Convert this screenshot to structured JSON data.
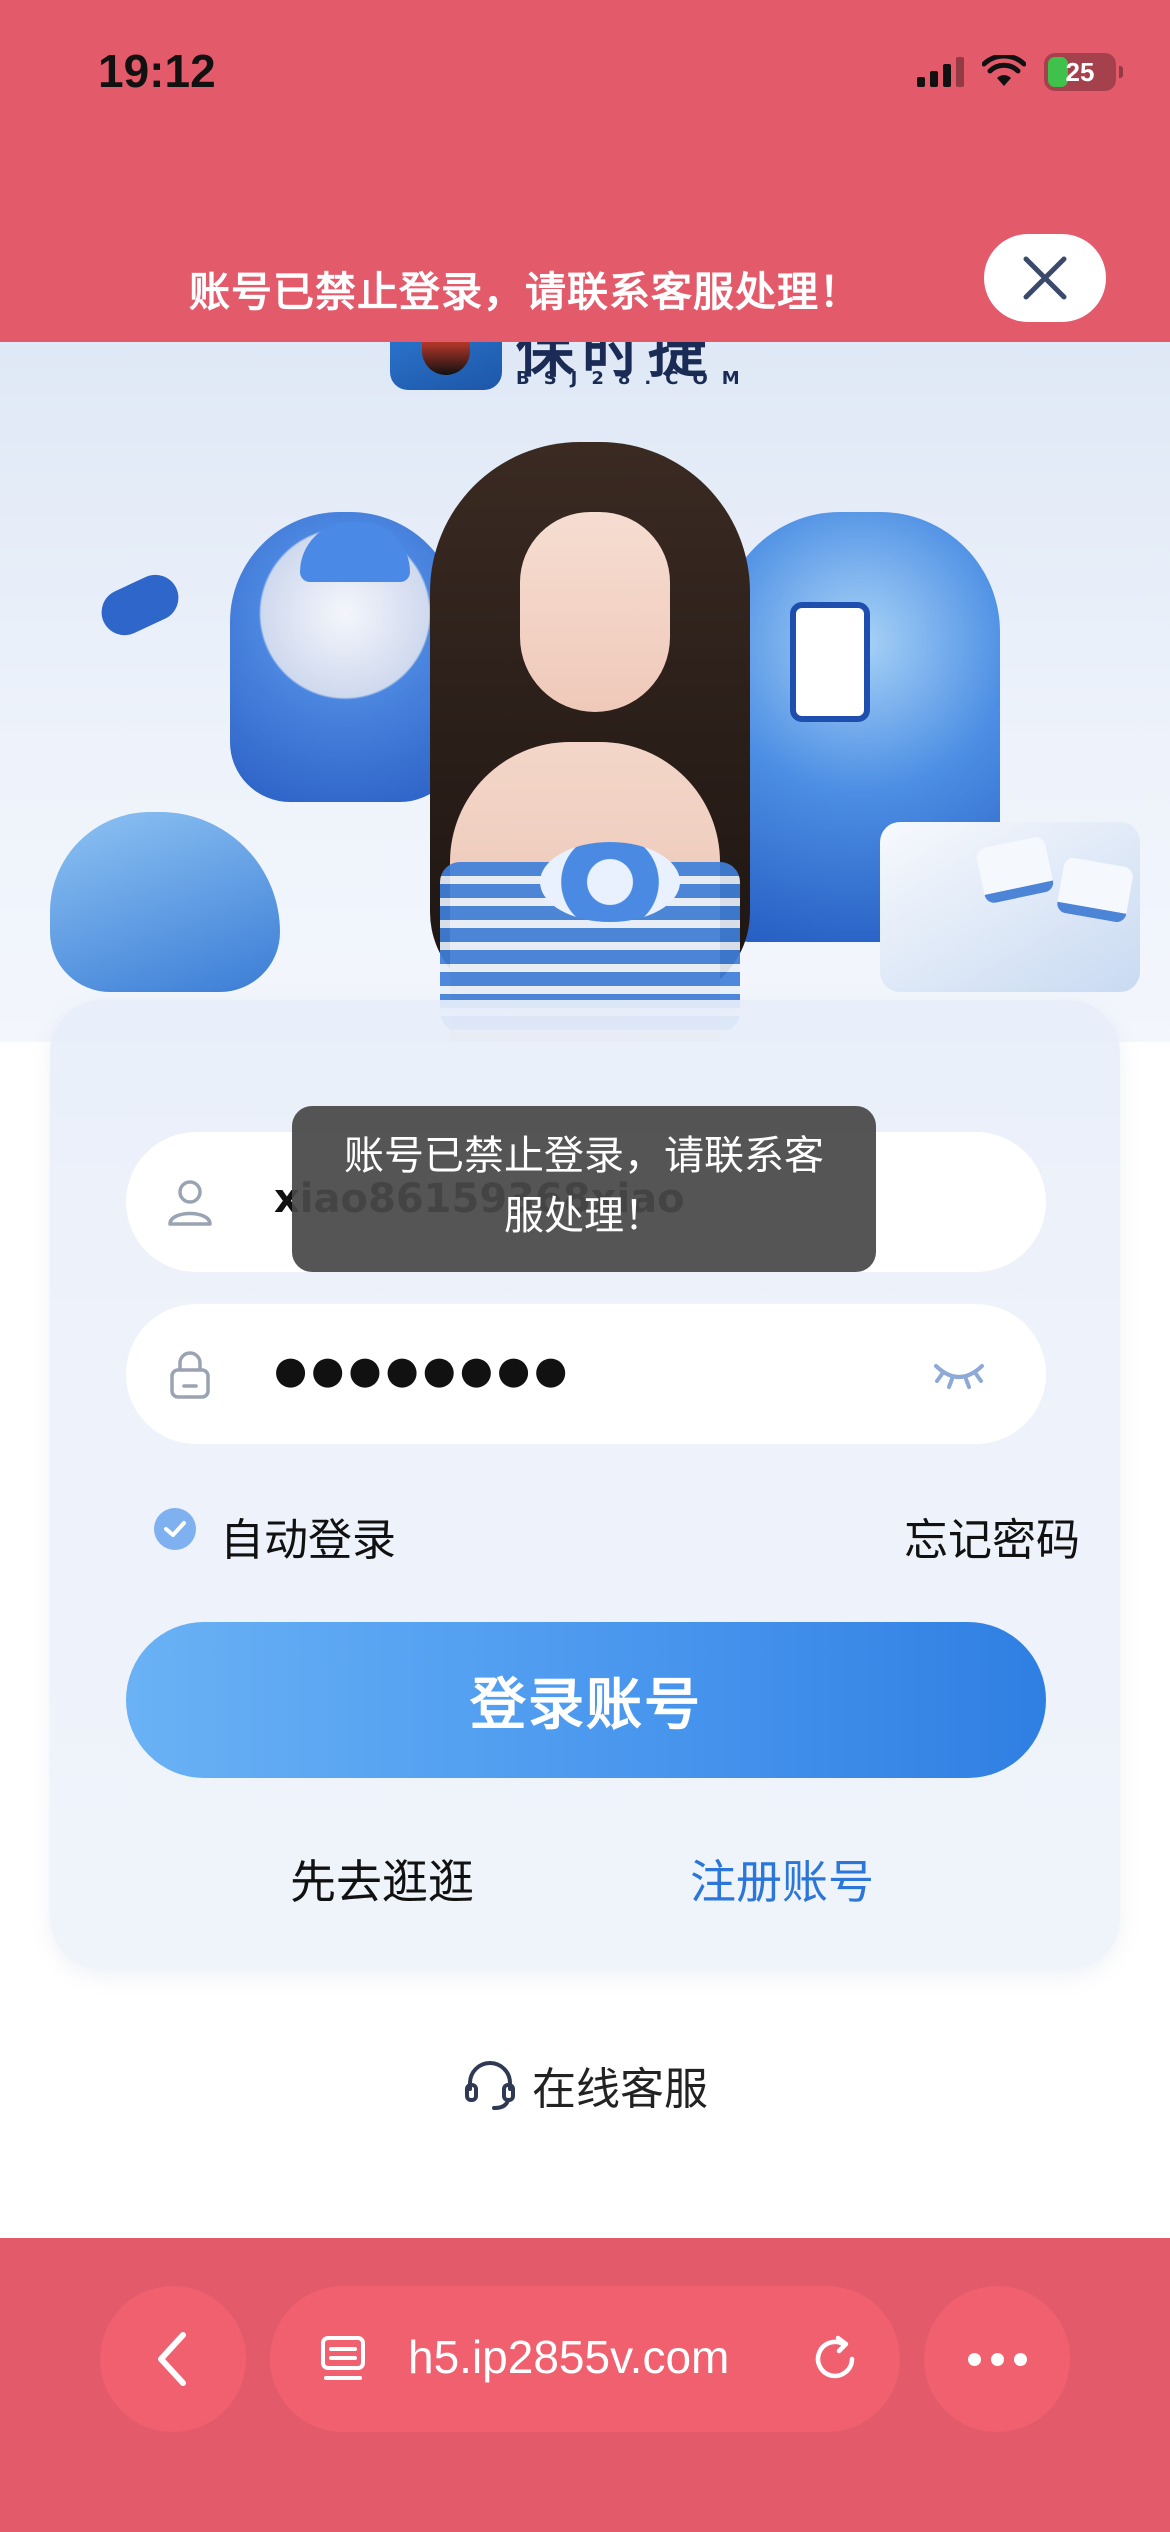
{
  "status_bar": {
    "time": "19:12",
    "battery_level": "25"
  },
  "ban_banner": {
    "message": "账号已禁止登录，请联系客服处理！",
    "close_icon": "close-icon"
  },
  "hero": {
    "logo_name": "保时捷",
    "logo_domain": "BSJ28.COM"
  },
  "login": {
    "username_value": "xiao86159368xiao",
    "password_mask": "●●●●●●●●",
    "auto_login_label": "自动登录",
    "auto_login_checked": true,
    "forgot_password_label": "忘记密码",
    "login_button_label": "登录账号",
    "browse_label": "先去逛逛",
    "register_label": "注册账号"
  },
  "toast": {
    "message": "账号已禁止登录，请联系客服处理！"
  },
  "support": {
    "label": "在线客服",
    "icon": "headset-icon"
  },
  "browser": {
    "url": "h5.ip2855v.com",
    "back_icon": "chevron-left-icon",
    "tabs_icon": "tabs-icon",
    "reload_icon": "reload-icon",
    "more_icon": "more-icon"
  },
  "colors": {
    "banner_red": "#e35a6b",
    "accent_blue": "#2b76d9",
    "button_gradient_start": "#6ab2f5",
    "button_gradient_end": "#2f7fe3"
  }
}
